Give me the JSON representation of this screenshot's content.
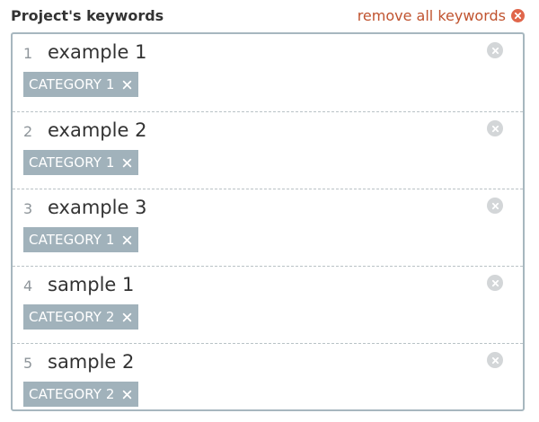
{
  "header": {
    "title": "Project's keywords",
    "remove_all_label": "remove all keywords"
  },
  "keywords": [
    {
      "index": "1",
      "text": "example 1",
      "category": "CATEGORY 1"
    },
    {
      "index": "2",
      "text": "example 2",
      "category": "CATEGORY 1"
    },
    {
      "index": "3",
      "text": "example 3",
      "category": "CATEGORY 1"
    },
    {
      "index": "4",
      "text": "sample 1",
      "category": "CATEGORY 2"
    },
    {
      "index": "5",
      "text": "sample 2",
      "category": "CATEGORY 2"
    }
  ],
  "colors": {
    "accent_remove_all": "#c0532f",
    "tag_bg": "#a1b2bb",
    "border": "#a7b7bf"
  },
  "icons": {
    "remove_all": "close-circle-icon",
    "row_remove": "close-circle-icon",
    "tag_remove": "close-icon"
  }
}
